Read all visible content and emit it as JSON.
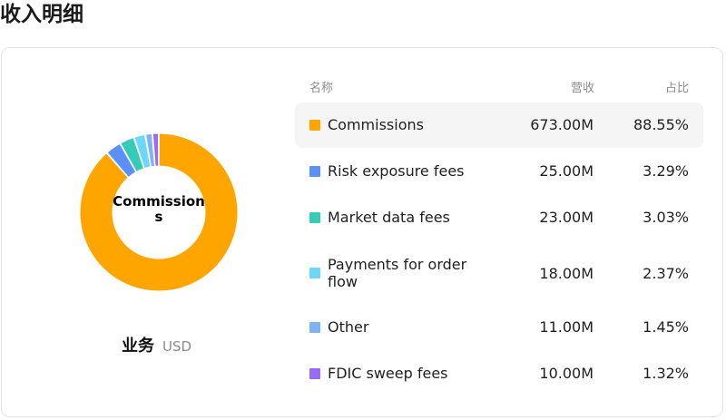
{
  "page": {
    "title": "收入明细"
  },
  "donut": {
    "center_label": "Commissions",
    "business_label": "业务",
    "currency": "USD"
  },
  "table": {
    "headers": {
      "name": "名称",
      "revenue": "营收",
      "share": "占比"
    },
    "rows": [
      {
        "name": "Commissions",
        "revenue": "673.00M",
        "share": "88.55%",
        "color": "#FFA500"
      },
      {
        "name": "Risk exposure fees",
        "revenue": "25.00M",
        "share": "3.29%",
        "color": "#5B8FF9"
      },
      {
        "name": "Market data fees",
        "revenue": "23.00M",
        "share": "3.03%",
        "color": "#36CBB7"
      },
      {
        "name": "Payments for order flow",
        "revenue": "18.00M",
        "share": "2.37%",
        "color": "#6DD8F5"
      },
      {
        "name": "Other",
        "revenue": "11.00M",
        "share": "1.45%",
        "color": "#7EB3F8"
      },
      {
        "name": "FDIC sweep fees",
        "revenue": "10.00M",
        "share": "1.32%",
        "color": "#9D6AF5"
      }
    ],
    "selected_index": 0
  },
  "chart_data": {
    "type": "pie",
    "categories": [
      "Commissions",
      "Risk exposure fees",
      "Market data fees",
      "Payments for order flow",
      "Other",
      "FDIC sweep fees"
    ],
    "values": [
      673.0,
      25.0,
      23.0,
      18.0,
      11.0,
      10.0
    ],
    "percentages": [
      88.55,
      3.29,
      3.03,
      2.37,
      1.45,
      1.32
    ],
    "colors": [
      "#FFA500",
      "#5B8FF9",
      "#36CBB7",
      "#6DD8F5",
      "#7EB3F8",
      "#9D6AF5"
    ],
    "title": "",
    "unit": "USD",
    "donut": true
  }
}
